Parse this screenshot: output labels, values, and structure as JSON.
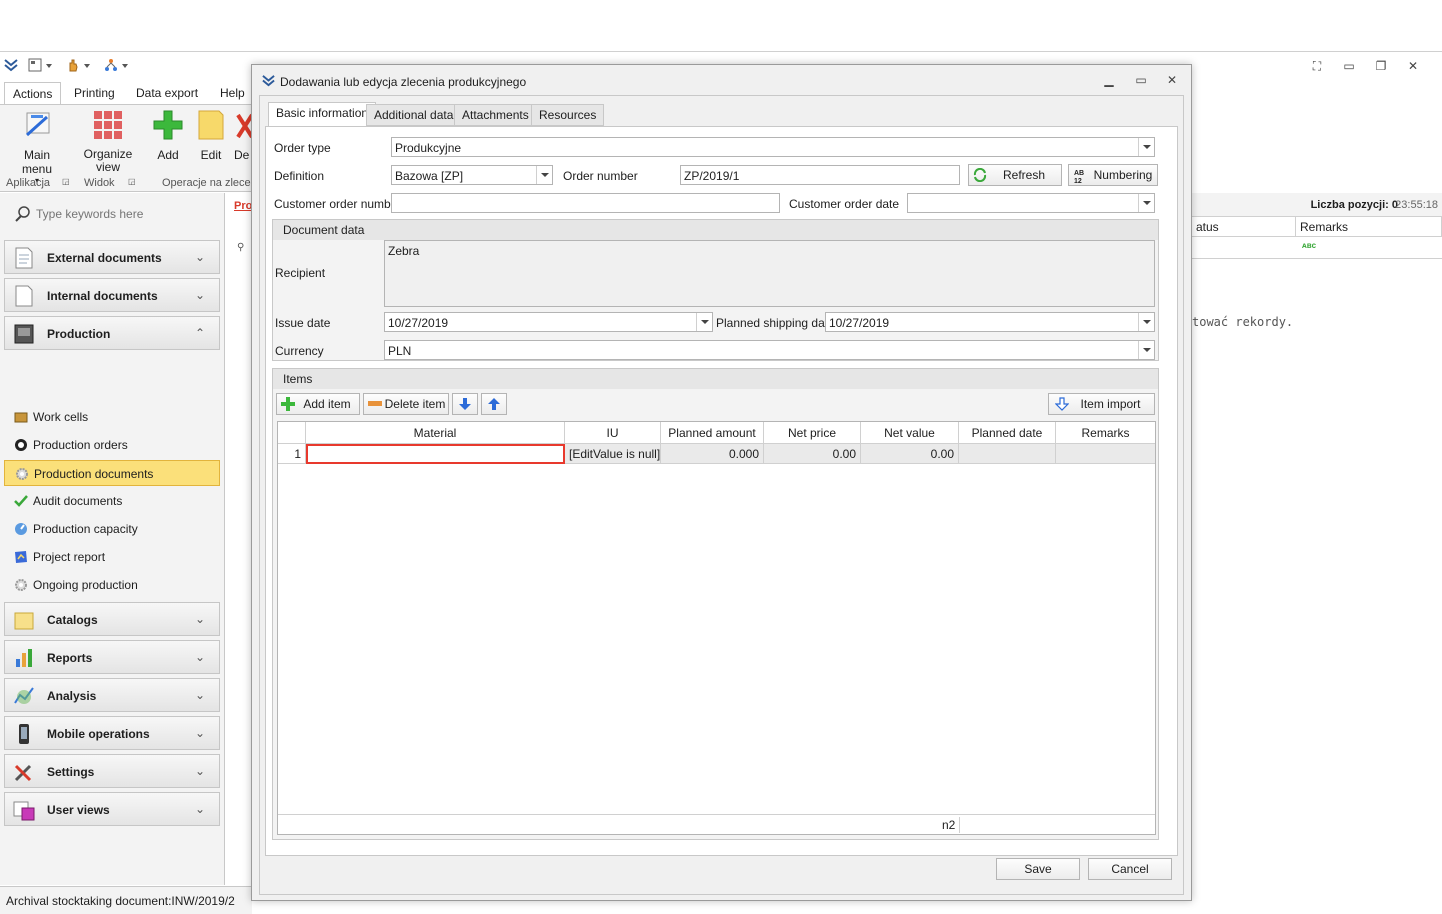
{
  "app": {
    "ribbon_tabs": [
      "Actions",
      "Printing",
      "Data export",
      "Help"
    ],
    "ribbon_buttons": {
      "main_menu": "Main menu",
      "organize_view": "Organize view",
      "add": "Add",
      "edit": "Edit",
      "partial": "De"
    },
    "ribbon_groups": [
      "Aplikacja",
      "Widok",
      "Operacje na zlecen"
    ],
    "search_placeholder": "Type keywords here",
    "nav_groups": [
      {
        "label": "External documents",
        "icon": "document-icon"
      },
      {
        "label": "Internal documents",
        "icon": "document-icon"
      },
      {
        "label": "Production",
        "icon": "production-icon"
      }
    ],
    "nav_items": [
      {
        "label": "Work cells",
        "icon": "work-cell-icon"
      },
      {
        "label": "Production orders",
        "icon": "production-order-icon"
      },
      {
        "label": "Production documents",
        "icon": "gear-icon"
      },
      {
        "label": "Audit documents",
        "icon": "checkmark-icon"
      },
      {
        "label": "Production capacity",
        "icon": "capacity-icon"
      },
      {
        "label": "Project report",
        "icon": "report-icon"
      },
      {
        "label": "Ongoing production",
        "icon": "gear-icon"
      }
    ],
    "nav_groups_bottom": [
      {
        "label": "Catalogs",
        "icon": "catalog-icon"
      },
      {
        "label": "Reports",
        "icon": "chart-icon"
      },
      {
        "label": "Analysis",
        "icon": "analysis-icon"
      },
      {
        "label": "Mobile operations",
        "icon": "mobile-icon"
      },
      {
        "label": "Settings",
        "icon": "tools-icon"
      },
      {
        "label": "User views",
        "icon": "user-views-icon"
      }
    ],
    "status_text": "Archival stocktaking document:INW/2019/2",
    "bg_tab_partial": "Pro",
    "bg_count": "Liczba pozycji: 0",
    "bg_time": "23:55:18",
    "bg_col_status": "atus",
    "bg_col_remarks": "Remarks",
    "bg_message": "tować rekordy."
  },
  "dialog": {
    "title": "Dodawania lub edycja zlecenia produkcyjnego",
    "tabs": [
      "Basic information",
      "Additional data",
      "Attachments",
      "Resources"
    ],
    "order_type_label": "Order type",
    "order_type_value": "Produkcyjne",
    "definition_label": "Definition",
    "definition_value": "Bazowa [ZP]",
    "order_number_label": "Order number",
    "order_number_value": "ZP/2019/1",
    "refresh_label": "Refresh",
    "numbering_label": "Numbering",
    "customer_order_number_label": "Customer order number",
    "customer_order_number_value": "",
    "customer_order_date_label": "Customer order date",
    "customer_order_date_value": "",
    "document_data_header": "Document data",
    "recipient_label": "Recipient",
    "recipient_value": "Zebra",
    "issue_date_label": "Issue date",
    "issue_date_value": "10/27/2019",
    "planned_shipping_label": "Planned shipping date",
    "planned_shipping_value": "10/27/2019",
    "currency_label": "Currency",
    "currency_value": "PLN",
    "items_header": "Items",
    "add_item_label": "Add item",
    "delete_item_label": "Delete item",
    "item_import_label": "Item import",
    "columns": [
      "Material",
      "IU",
      "Planned amount",
      "Net price",
      "Net value",
      "Planned date",
      "Remarks"
    ],
    "row": {
      "num": "1",
      "material": "",
      "iu": "[EditValue is null]",
      "planned_amount": "0.000",
      "net_price": "0.00",
      "net_value": "0.00",
      "planned_date": "",
      "remarks": ""
    },
    "footer_summary": "n2",
    "save_label": "Save",
    "cancel_label": "Cancel"
  },
  "colors": {
    "accent": "#fbe07a",
    "highlight_border": "#e8392d"
  }
}
